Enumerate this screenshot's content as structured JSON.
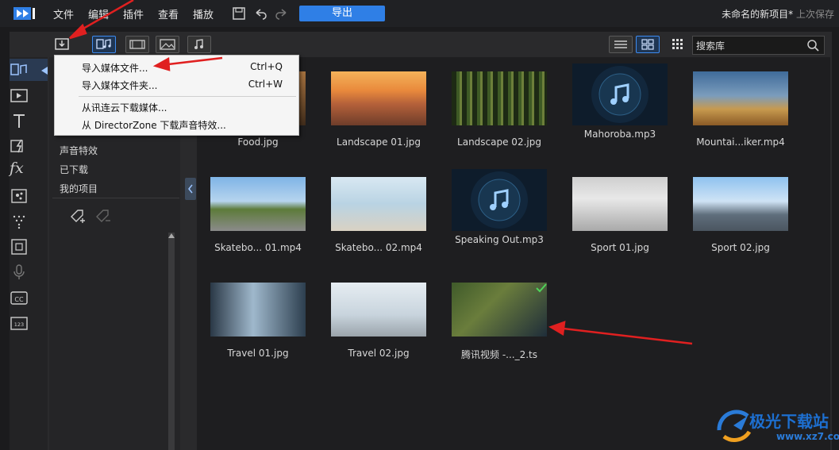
{
  "menubar": {
    "items": [
      "文件",
      "编辑",
      "插件",
      "查看",
      "播放"
    ],
    "export_label": "导出",
    "project_title": "未命名的新项目*",
    "last_saved": "上次保存"
  },
  "search": {
    "placeholder": "搜索库"
  },
  "dropdown": {
    "items": [
      {
        "label": "导入媒体文件...",
        "shortcut": "Ctrl+Q"
      },
      {
        "label": "导入媒体文件夹...",
        "shortcut": "Ctrl+W"
      },
      {
        "label": "从讯连云下载媒体...",
        "shortcut": ""
      },
      {
        "label": "从 DirectorZone 下载声音特效...",
        "shortcut": ""
      }
    ]
  },
  "library": {
    "items": [
      "声音特效",
      "已下载",
      "我的项目"
    ]
  },
  "media": [
    {
      "name": "Food.jpg"
    },
    {
      "name": "Landscape 01.jpg"
    },
    {
      "name": "Landscape 02.jpg"
    },
    {
      "name": "Mahoroba.mp3"
    },
    {
      "name": "Mountai...iker.mp4"
    },
    {
      "name": "Skatebo... 01.mp4"
    },
    {
      "name": "Skatebo... 02.mp4"
    },
    {
      "name": "Speaking Out.mp3"
    },
    {
      "name": "Sport 01.jpg"
    },
    {
      "name": "Sport 02.jpg"
    },
    {
      "name": "Travel 01.jpg"
    },
    {
      "name": "Travel 02.jpg"
    },
    {
      "name": "腾讯视频 -..._2.ts"
    }
  ],
  "watermark": {
    "text": "极光下载站",
    "url": "www.xz7.com"
  },
  "colors": {
    "accent": "#2f7fe6",
    "annotation": "#e02020"
  }
}
